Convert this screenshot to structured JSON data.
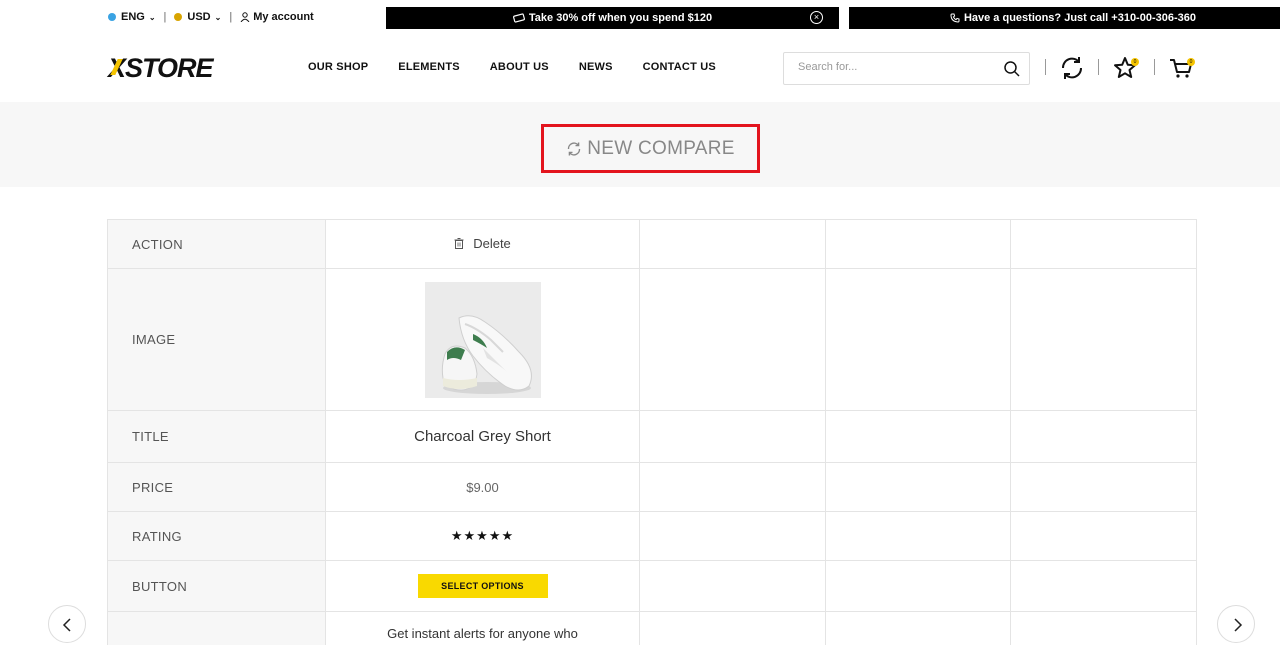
{
  "topbar": {
    "language": "ENG",
    "currency": "USD",
    "account": "My account",
    "promo": "Take 30% off when you spend $120",
    "phone": "Have a questions? Just call +310-00-306-360"
  },
  "header": {
    "logo": "XSTORE",
    "nav": [
      "OUR SHOP",
      "ELEMENTS",
      "ABOUT US",
      "NEWS",
      "CONTACT US"
    ],
    "search_placeholder": "Search for...",
    "wishlist_count": "0",
    "cart_count": "0"
  },
  "page": {
    "title": "NEW COMPARE"
  },
  "compare": {
    "rows": {
      "action": "ACTION",
      "image": "IMAGE",
      "title": "TITLE",
      "price": "PRICE",
      "rating": "RATING",
      "button": "BUTTON"
    },
    "product": {
      "delete": "Delete",
      "title": "Charcoal Grey Short",
      "price": "$9.00",
      "rating": "★★★★★",
      "button": "SELECT OPTIONS",
      "description": "Get instant alerts for anyone who"
    }
  },
  "colors": {
    "accent": "#f9d900",
    "highlight": "#e3141e",
    "lang_dot": "#3aa3e3"
  }
}
